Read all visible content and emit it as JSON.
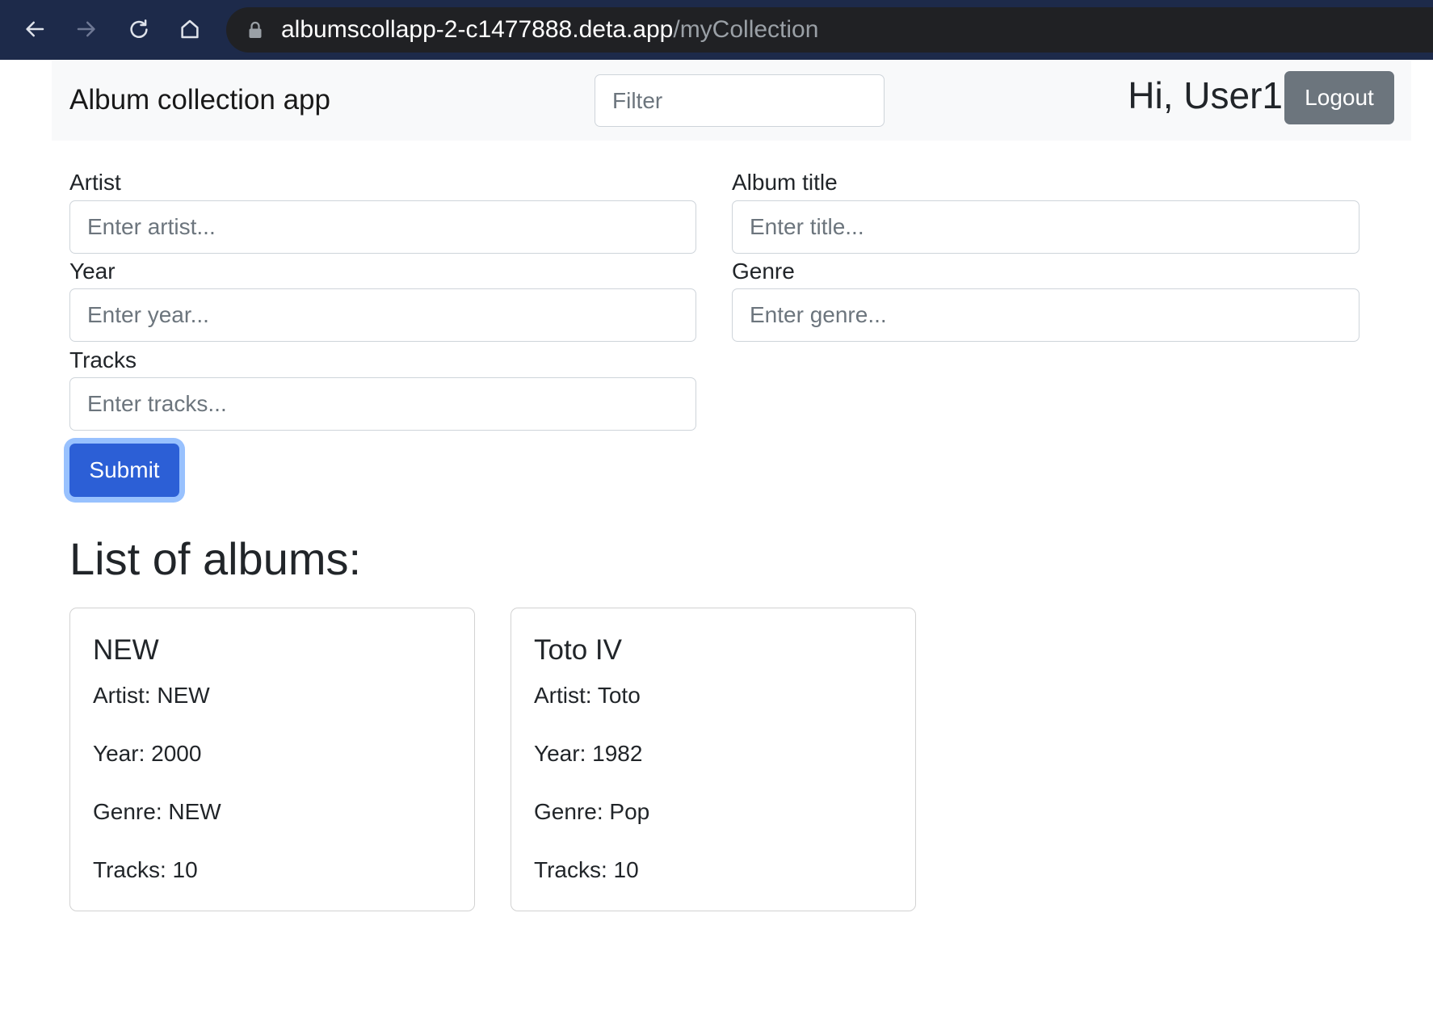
{
  "browser": {
    "url_host": "albumscollapp-2-c1477888.deta.app",
    "url_path": "/myCollection",
    "icons": [
      "back-arrow-icon",
      "forward-arrow-icon",
      "reload-icon",
      "home-icon",
      "lock-icon"
    ]
  },
  "navbar": {
    "brand": "Album collection app",
    "filter_placeholder": "Filter",
    "greeting": "Hi, User1",
    "logout_label": "Logout"
  },
  "form": {
    "fields": [
      {
        "label": "Artist",
        "placeholder": "Enter artist..."
      },
      {
        "label": "Album title",
        "placeholder": "Enter title..."
      },
      {
        "label": "Year",
        "placeholder": "Enter year..."
      },
      {
        "label": "Genre",
        "placeholder": "Enter genre..."
      },
      {
        "label": "Tracks",
        "placeholder": "Enter tracks..."
      }
    ],
    "submit_label": "Submit"
  },
  "albums_section": {
    "heading": "List of albums:",
    "field_labels": {
      "artist": "Artist:",
      "year": "Year:",
      "genre": "Genre:",
      "tracks": "Tracks:"
    },
    "albums": [
      {
        "title": "NEW",
        "artist": "NEW",
        "year": "2000",
        "genre": "NEW",
        "tracks": "10"
      },
      {
        "title": "Toto IV",
        "artist": "Toto",
        "year": "1982",
        "genre": "Pop",
        "tracks": "10"
      }
    ]
  },
  "theme": {
    "browser-bar": "#1d2a4a",
    "address-bar": "#202124",
    "url-host": "#ffffff",
    "url-path": "#9aa0a6",
    "navbar-bg": "#f8f9fa",
    "primary": "#2c5fd6",
    "focus-ring": "rgba(49,132,253,0.5)",
    "secondary": "#6c757d",
    "text": "#212529",
    "placeholder": "#6c757d"
  }
}
